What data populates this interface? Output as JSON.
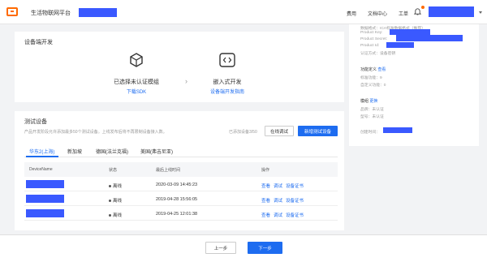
{
  "header": {
    "app_title": "生活物联网平台",
    "nav": {
      "fees": "费用",
      "docs": "文档中心",
      "tickets": "工单"
    }
  },
  "device_dev": {
    "title": "设备端开发",
    "step1": {
      "label": "已选择未认证模组",
      "link": "下载SDK"
    },
    "step2": {
      "label": "嵌入式开发",
      "link": "设备端开发指南"
    }
  },
  "test_devices": {
    "title": "测试设备",
    "description": "产品开发阶段允许添加最多50个测试设备。上线发布后将不再限制设备接入数。",
    "added_count": "已添加设备3/50",
    "online_debug_label": "在线调试",
    "add_device_label": "新增测试设备",
    "tabs": [
      "华东2(上海)",
      "新加坡",
      "德国(法兰克福)",
      "美国(弗吉尼亚)"
    ],
    "columns": {
      "name": "DeviceName",
      "status": "状态",
      "last_online": "最后上线时间",
      "ops": "操作"
    },
    "rows": [
      {
        "status": "离线",
        "last_online": "2020-03-09 14:45:23",
        "ops": [
          "查看",
          "调试",
          "设备证书"
        ]
      },
      {
        "status": "离线",
        "last_online": "2019-04-28 15:56:05",
        "ops": [
          "查看",
          "调试",
          "设备证书"
        ]
      },
      {
        "status": "离线",
        "last_online": "2019-04-25 12:01:38",
        "ops": [
          "查看",
          "调试",
          "设备证书"
        ]
      }
    ]
  },
  "sidebar": {
    "data_format": "数据格式：ICA标准数据格式（推荐）",
    "product_key": "Product Key:",
    "product_secret": "Product Secret:",
    "product_id": "Product Id:",
    "auth_method": "认证方式：设备密钥",
    "func_def_label": "功能定义",
    "func_def_link": "查看",
    "std_func": "标准功能：9",
    "custom_func": "自定义功能：0",
    "module_label": "模组",
    "module_link": "更换",
    "brand": "品牌：未认证",
    "model": "型号：未认证",
    "created": "创建时间："
  },
  "footer": {
    "prev": "上一步",
    "next": "下一步"
  }
}
